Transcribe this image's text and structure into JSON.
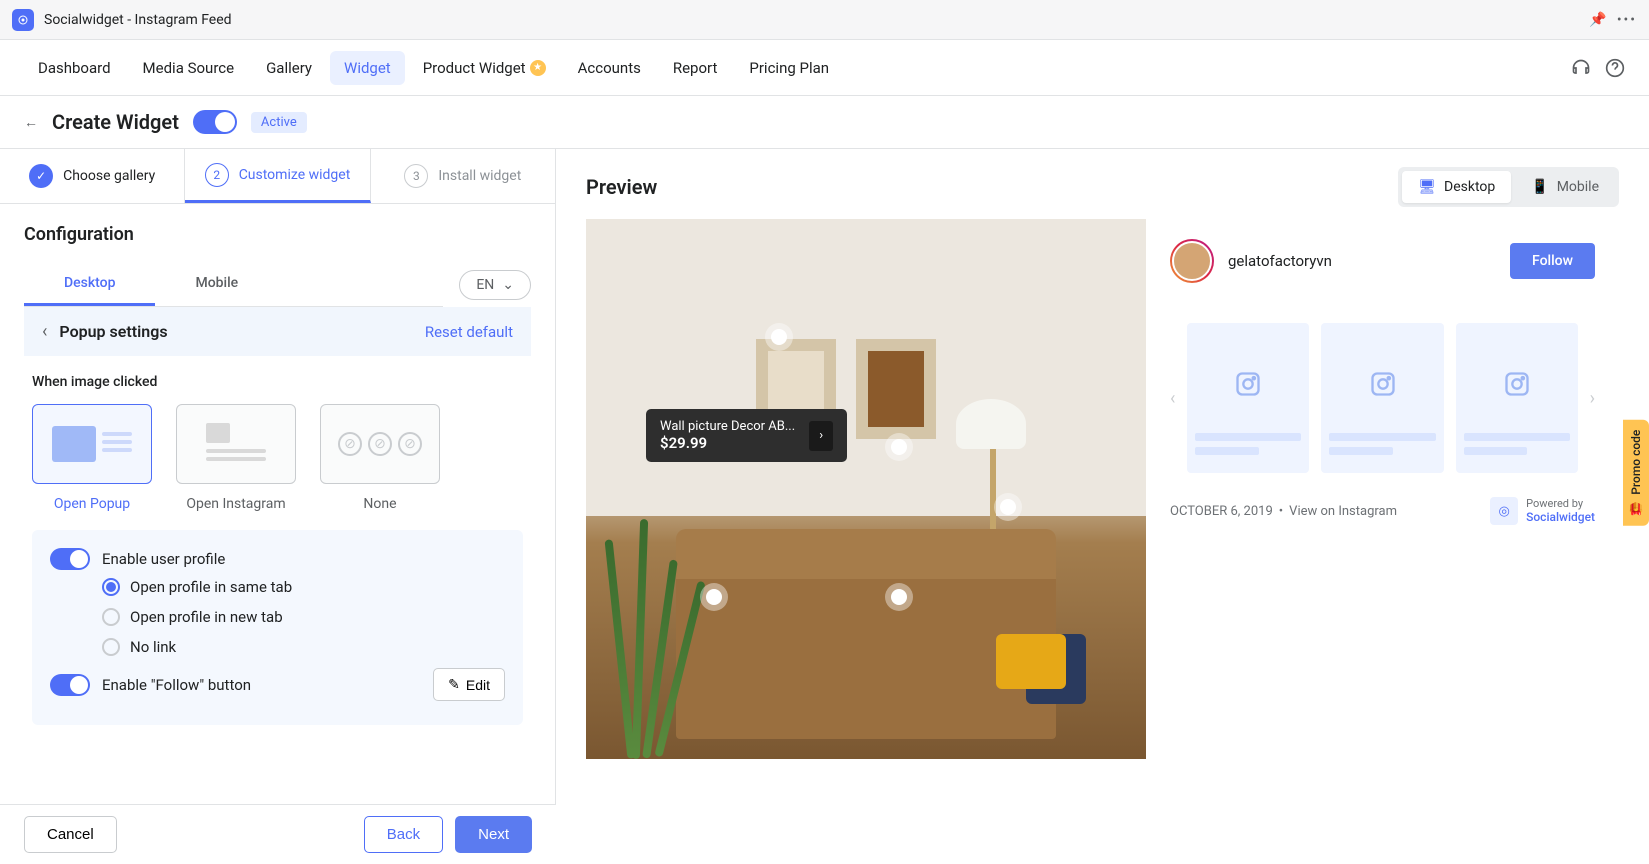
{
  "app": {
    "name": "Socialwidget - Instagram Feed"
  },
  "nav": {
    "items": [
      "Dashboard",
      "Media Source",
      "Gallery",
      "Widget",
      "Product Widget",
      "Accounts",
      "Report",
      "Pricing Plan"
    ],
    "active_index": 3
  },
  "page": {
    "title": "Create Widget",
    "status_label": "Active"
  },
  "steps": {
    "step1": "Choose gallery",
    "step2": "Customize widget",
    "step3": "Install widget"
  },
  "config": {
    "title": "Configuration",
    "tab_desktop": "Desktop",
    "tab_mobile": "Mobile",
    "language": "EN",
    "section_title": "Popup settings",
    "reset": "Reset default",
    "when_clicked_label": "When image clicked",
    "options": {
      "open_popup": "Open Popup",
      "open_instagram": "Open Instagram",
      "none": "None"
    },
    "enable_profile": "Enable user profile",
    "radios": {
      "same_tab": "Open profile in same tab",
      "new_tab": "Open profile in new tab",
      "no_link": "No link"
    },
    "enable_follow": "Enable \"Follow\" button",
    "edit_btn": "Edit"
  },
  "footer": {
    "cancel": "Cancel",
    "back": "Back",
    "next": "Next"
  },
  "preview": {
    "title": "Preview",
    "desktop": "Desktop",
    "mobile": "Mobile",
    "product_name": "Wall picture Decor AB...",
    "product_price": "$29.99",
    "username": "gelatofactoryvn",
    "follow": "Follow",
    "meta_date": "OCTOBER 6, 2019",
    "meta_view": "View on Instagram",
    "powered_by_label": "Powered by",
    "powered_by_brand": "Socialwidget"
  },
  "promo": {
    "label": "Promo code"
  }
}
